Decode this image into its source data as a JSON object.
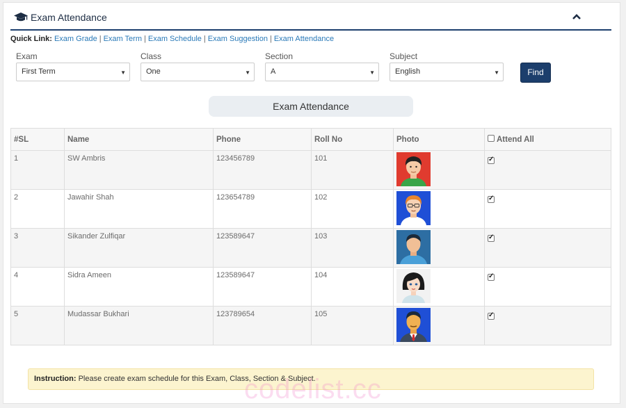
{
  "header": {
    "title": "Exam Attendance",
    "cap_icon": "graduation-cap-icon",
    "collapse_icon": "chevron-up-icon"
  },
  "quick_links": {
    "label": "Quick Link:",
    "links": [
      "Exam Grade",
      "Exam Term",
      "Exam Schedule",
      "Exam Suggestion",
      "Exam Attendance"
    ]
  },
  "filters": {
    "exam": {
      "label": "Exam",
      "value": "First Term"
    },
    "class": {
      "label": "Class",
      "value": "One"
    },
    "section": {
      "label": "Section",
      "value": "A"
    },
    "subject": {
      "label": "Subject",
      "value": "English"
    },
    "find_label": "Find"
  },
  "section_title": "Exam Attendance",
  "table": {
    "headers": {
      "sl": "#SL",
      "name": "Name",
      "phone": "Phone",
      "roll": "Roll No",
      "photo": "Photo",
      "attend_all": "Attend All"
    },
    "rows": [
      {
        "sl": "1",
        "name": "SW Ambris",
        "phone": "123456789",
        "roll": "101",
        "attend": true
      },
      {
        "sl": "2",
        "name": "Jawahir Shah",
        "phone": "123654789",
        "roll": "102",
        "attend": true
      },
      {
        "sl": "3",
        "name": "Sikander Zulfiqar",
        "phone": "123589647",
        "roll": "103",
        "attend": true
      },
      {
        "sl": "4",
        "name": "Sidra Ameen",
        "phone": "123589647",
        "roll": "104",
        "attend": true
      },
      {
        "sl": "5",
        "name": "Mudassar Bukhari",
        "phone": "123789654",
        "roll": "105",
        "attend": true
      }
    ]
  },
  "notice": {
    "label": "Instruction:",
    "text": "Please create exam schedule for this Exam, Class, Section & Subject."
  },
  "watermark": "codelist.cc",
  "colors": {
    "accent": "#1c3e6c",
    "link": "#2a7ab8",
    "notice_bg": "#fcf4cf"
  }
}
